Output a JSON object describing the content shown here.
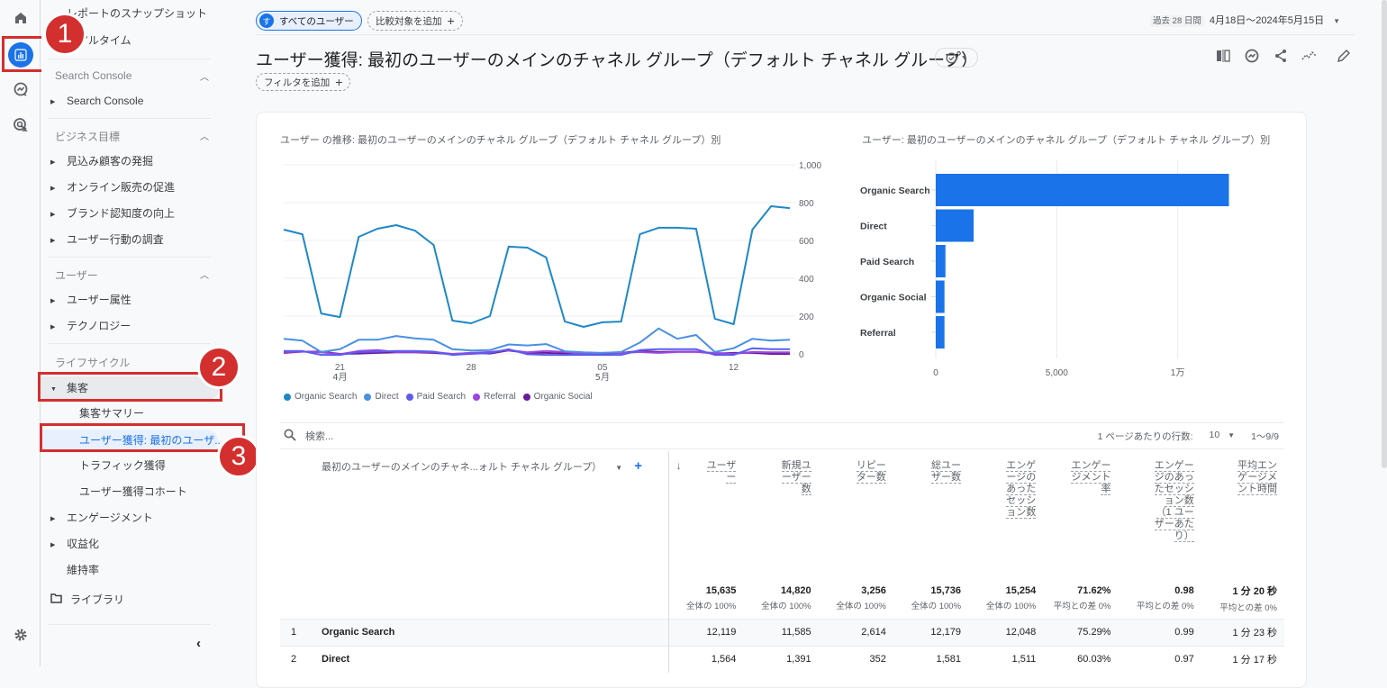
{
  "rail": {
    "icons": [
      "home-icon",
      "reports-icon",
      "explore-icon",
      "advertising-icon",
      "settings-icon"
    ]
  },
  "sidebar": {
    "top_items": [
      "レポートのスナップショット",
      "リアルタイム"
    ],
    "sections": [
      {
        "title": "Search Console",
        "items": [
          "Search Console"
        ]
      },
      {
        "title": "ビジネス目標",
        "items": [
          "見込み顧客の発掘",
          "オンライン販売の促進",
          "ブランド認知度の向上",
          "ユーザー行動の調査"
        ]
      },
      {
        "title": "ユーザー",
        "items": [
          "ユーザー属性",
          "テクノロジー"
        ]
      }
    ],
    "lifecycle_title": "ライフサイクル",
    "acquisition": {
      "label": "集客",
      "children": [
        "集客サマリー",
        "ユーザー獲得: 最初のユーザ...",
        "トラフィック獲得",
        "ユーザー獲得コホート"
      ]
    },
    "after_items": [
      "エンゲージメント",
      "収益化"
    ],
    "retention": "維持率",
    "library": "ライブラリ",
    "collapse_icon": "chevron-left-icon"
  },
  "annotations": [
    "1",
    "2",
    "3"
  ],
  "topbar": {
    "segment_initial": "す",
    "segment_label": "すべてのユーザー",
    "add_comparison": "比較対象を追加",
    "date_prefix": "過去 28 日間",
    "date_range": "4月18日〜2024年5月15日"
  },
  "page": {
    "title": "ユーザー獲得: 最初のユーザーのメインのチャネル グループ（デフォルト チャネル グループ）",
    "add_filter": "フィルタを追加"
  },
  "colors": {
    "accent": "#1a73e8",
    "annotation": "#d32f2f"
  },
  "chart_data": [
    {
      "type": "line",
      "title": "ユーザー の推移: 最初のユーザーのメインのチャネル グループ（デフォルト チャネル グループ）別",
      "x": [
        "04-18",
        "04-19",
        "04-20",
        "04-21",
        "04-22",
        "04-23",
        "04-24",
        "04-25",
        "04-26",
        "04-27",
        "04-28",
        "04-29",
        "04-30",
        "05-01",
        "05-02",
        "05-03",
        "05-04",
        "05-05",
        "05-06",
        "05-07",
        "05-08",
        "05-09",
        "05-10",
        "05-11",
        "05-12",
        "05-13",
        "05-14",
        "05-15"
      ],
      "x_ticks": [
        {
          "label": "21",
          "sub": "4月",
          "index": 3
        },
        {
          "label": "28",
          "sub": "",
          "index": 10
        },
        {
          "label": "05",
          "sub": "5月",
          "index": 17
        },
        {
          "label": "12",
          "sub": "",
          "index": 24
        }
      ],
      "y_ticks": [
        "0",
        "200",
        "400",
        "600",
        "800",
        "1,000"
      ],
      "ylim": [
        0,
        1000
      ],
      "grid": true,
      "legend_position": "bottom-left",
      "series": [
        {
          "name": "Organic Search",
          "color": "#1e88c7",
          "values": [
            657,
            633,
            214,
            195,
            619,
            662,
            681,
            652,
            576,
            176,
            162,
            200,
            567,
            562,
            510,
            171,
            143,
            167,
            171,
            633,
            667,
            667,
            662,
            186,
            157,
            657,
            781,
            771
          ]
        },
        {
          "name": "Direct",
          "color": "#4a90e2",
          "values": [
            80,
            70,
            10,
            25,
            75,
            75,
            95,
            82,
            75,
            25,
            18,
            20,
            50,
            45,
            52,
            14,
            8,
            5,
            10,
            60,
            135,
            80,
            100,
            10,
            30,
            80,
            70,
            75
          ]
        },
        {
          "name": "Paid Search",
          "color": "#5c5cf0",
          "values": [
            15,
            15,
            -5,
            -5,
            10,
            12,
            15,
            15,
            12,
            -5,
            0,
            5,
            25,
            -2,
            -5,
            -5,
            -5,
            -5,
            -5,
            20,
            25,
            25,
            25,
            -5,
            -5,
            30,
            25,
            25
          ]
        },
        {
          "name": "Referral",
          "color": "#9c46e0",
          "values": [
            10,
            12,
            8,
            -2,
            15,
            20,
            10,
            10,
            10,
            0,
            5,
            10,
            20,
            8,
            15,
            10,
            0,
            5,
            5,
            10,
            5,
            10,
            10,
            5,
            0,
            10,
            8,
            8
          ]
        },
        {
          "name": "Organic Social",
          "color": "#6a1b9a",
          "values": [
            5,
            12,
            12,
            0,
            2,
            5,
            8,
            8,
            5,
            -2,
            5,
            2,
            18,
            5,
            5,
            2,
            0,
            2,
            5,
            15,
            10,
            12,
            12,
            2,
            5,
            5,
            0,
            0
          ]
        }
      ]
    },
    {
      "type": "bar",
      "orientation": "horizontal",
      "title": "ユーザー: 最初のユーザーのメインのチャネル グループ（デフォルト チャネル グループ）別",
      "categories": [
        "Organic Search",
        "Direct",
        "Paid Search",
        "Organic Social",
        "Referral"
      ],
      "values": [
        12119,
        1564,
        400,
        360,
        360
      ],
      "x_ticks": [
        "0",
        "5,000",
        "1万"
      ],
      "xlim": [
        0,
        14000
      ],
      "color": "#1a73e8"
    }
  ],
  "table": {
    "search_placeholder": "検索...",
    "rows_per_page_label": "1 ページあたりの行数:",
    "rows_per_page": "10",
    "pagination": "1〜9/9",
    "dimension_header": "最初のユーザーのメインのチャネ...ォルト チャネル グループ）",
    "columns": [
      "ユーザー",
      "新規ユーザー数",
      "リピーター数",
      "総ユーザー数",
      "エンゲージのあったセッション数",
      "エンゲージメント率",
      "エンゲージのあったセッション数（1 ユーザーあたり）",
      "平均エンゲージメント時間"
    ],
    "totals": [
      {
        "value": "15,635",
        "sub": "全体の 100%"
      },
      {
        "value": "14,820",
        "sub": "全体の 100%"
      },
      {
        "value": "3,256",
        "sub": "全体の 100%"
      },
      {
        "value": "15,736",
        "sub": "全体の 100%"
      },
      {
        "value": "15,254",
        "sub": "全体の 100%"
      },
      {
        "value": "71.62%",
        "sub": "平均との差 0%"
      },
      {
        "value": "0.98",
        "sub": "平均との差 0%"
      },
      {
        "value": "1 分 20 秒",
        "sub": "平均との差 0%"
      }
    ],
    "rows": [
      {
        "rank": "1",
        "channel": "Organic Search",
        "values": [
          "12,119",
          "11,585",
          "2,614",
          "12,179",
          "12,048",
          "75.29%",
          "0.99",
          "1 分 23 秒"
        ]
      },
      {
        "rank": "2",
        "channel": "Direct",
        "values": [
          "1,564",
          "1,391",
          "352",
          "1,581",
          "1,511",
          "60.03%",
          "0.97",
          "1 分 17 秒"
        ]
      }
    ]
  }
}
